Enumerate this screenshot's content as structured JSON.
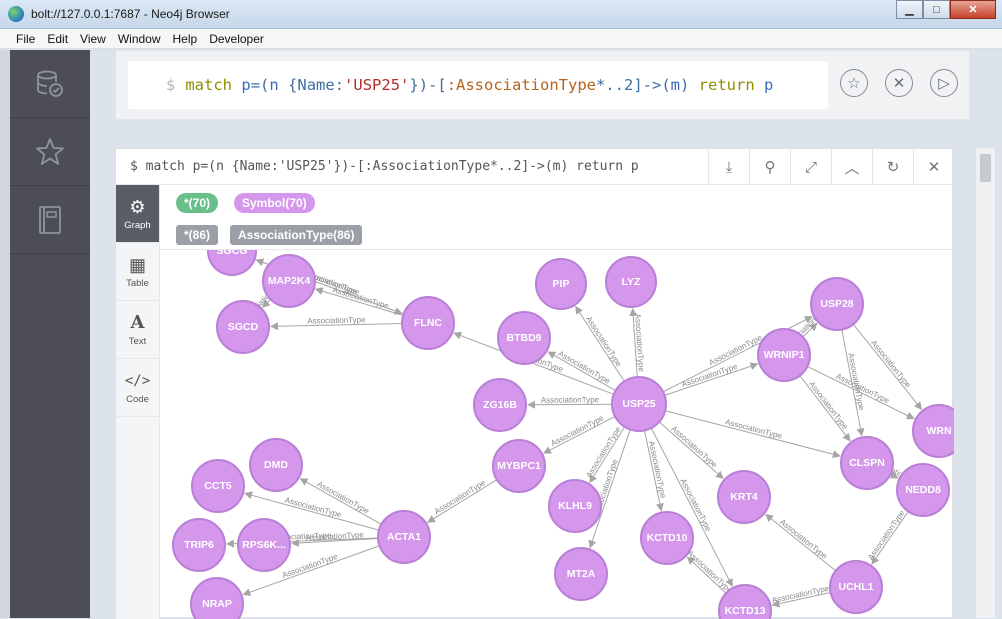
{
  "window": {
    "title": "bolt://127.0.0.1:7687 - Neo4j Browser",
    "minimize": "▁",
    "maximize": "□",
    "close": "✕"
  },
  "menu": [
    "File",
    "Edit",
    "View",
    "Window",
    "Help",
    "Developer"
  ],
  "editor": {
    "prompt": "$",
    "query_tokens": [
      {
        "t": "match ",
        "c": "kw"
      },
      {
        "t": "p",
        "c": "var"
      },
      {
        "t": "=(",
        "c": "plain"
      },
      {
        "t": "n",
        "c": "var"
      },
      {
        "t": " {Name:",
        "c": "plain"
      },
      {
        "t": "'USP25'",
        "c": "str"
      },
      {
        "t": "})-[",
        "c": "plain"
      },
      {
        "t": ":AssociationType",
        "c": "rel"
      },
      {
        "t": "*..2]->(",
        "c": "plain"
      },
      {
        "t": "m",
        "c": "var"
      },
      {
        "t": ") ",
        "c": "plain"
      },
      {
        "t": "return ",
        "c": "kw"
      },
      {
        "t": "p",
        "c": "var"
      }
    ]
  },
  "frame": {
    "query": "$ match p=(n {Name:'USP25'})-[:AssociationType*..2]->(m) return p",
    "tabs": [
      {
        "label": "Graph",
        "icon": "graph-icon",
        "active": true
      },
      {
        "label": "Table",
        "icon": "table-icon"
      },
      {
        "label": "Text",
        "icon": "text-icon"
      },
      {
        "label": "Code",
        "icon": "code-icon"
      }
    ],
    "legend": {
      "node_all": "*(70)",
      "node_symbol": "Symbol(70)",
      "rel_all": "*(86)",
      "rel_type": "AssociationType(86)"
    }
  },
  "graph": {
    "edge_label": "AssociationType",
    "node_color": "#d497ec",
    "node_stroke": "#b97fd6",
    "edge_color": "#a5a5a5",
    "nodes": [
      "SGCG",
      "MAP2K4",
      "SGCD",
      "FLNC",
      "PIP",
      "LYZ",
      "BTBD9",
      "USP28",
      "WRNIP1",
      "ZG16B",
      "USP25",
      "WRN",
      "MYBPC1",
      "KLHL9",
      "CCT5",
      "DMD",
      "KRT4",
      "CLSPN",
      "NEDD8",
      "ACTA1",
      "KCTD10",
      "TRIP6",
      "RPS6K...",
      "MT2A",
      "UCHL1",
      "NRAP",
      "KCTD13"
    ]
  }
}
